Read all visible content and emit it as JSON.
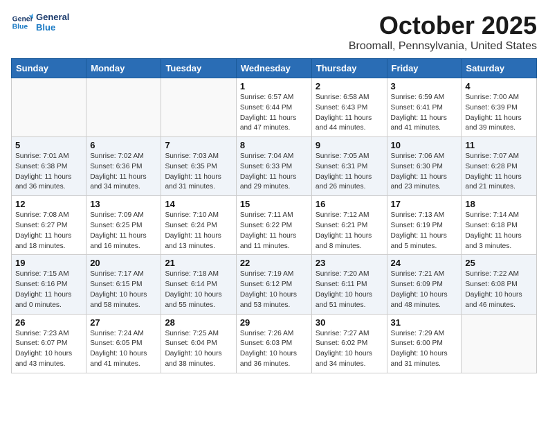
{
  "header": {
    "logo_line1": "General",
    "logo_line2": "Blue",
    "title": "October 2025",
    "subtitle": "Broomall, Pennsylvania, United States"
  },
  "weekdays": [
    "Sunday",
    "Monday",
    "Tuesday",
    "Wednesday",
    "Thursday",
    "Friday",
    "Saturday"
  ],
  "weeks": [
    [
      {
        "day": "",
        "info": ""
      },
      {
        "day": "",
        "info": ""
      },
      {
        "day": "",
        "info": ""
      },
      {
        "day": "1",
        "info": "Sunrise: 6:57 AM\nSunset: 6:44 PM\nDaylight: 11 hours\nand 47 minutes."
      },
      {
        "day": "2",
        "info": "Sunrise: 6:58 AM\nSunset: 6:43 PM\nDaylight: 11 hours\nand 44 minutes."
      },
      {
        "day": "3",
        "info": "Sunrise: 6:59 AM\nSunset: 6:41 PM\nDaylight: 11 hours\nand 41 minutes."
      },
      {
        "day": "4",
        "info": "Sunrise: 7:00 AM\nSunset: 6:39 PM\nDaylight: 11 hours\nand 39 minutes."
      }
    ],
    [
      {
        "day": "5",
        "info": "Sunrise: 7:01 AM\nSunset: 6:38 PM\nDaylight: 11 hours\nand 36 minutes."
      },
      {
        "day": "6",
        "info": "Sunrise: 7:02 AM\nSunset: 6:36 PM\nDaylight: 11 hours\nand 34 minutes."
      },
      {
        "day": "7",
        "info": "Sunrise: 7:03 AM\nSunset: 6:35 PM\nDaylight: 11 hours\nand 31 minutes."
      },
      {
        "day": "8",
        "info": "Sunrise: 7:04 AM\nSunset: 6:33 PM\nDaylight: 11 hours\nand 29 minutes."
      },
      {
        "day": "9",
        "info": "Sunrise: 7:05 AM\nSunset: 6:31 PM\nDaylight: 11 hours\nand 26 minutes."
      },
      {
        "day": "10",
        "info": "Sunrise: 7:06 AM\nSunset: 6:30 PM\nDaylight: 11 hours\nand 23 minutes."
      },
      {
        "day": "11",
        "info": "Sunrise: 7:07 AM\nSunset: 6:28 PM\nDaylight: 11 hours\nand 21 minutes."
      }
    ],
    [
      {
        "day": "12",
        "info": "Sunrise: 7:08 AM\nSunset: 6:27 PM\nDaylight: 11 hours\nand 18 minutes."
      },
      {
        "day": "13",
        "info": "Sunrise: 7:09 AM\nSunset: 6:25 PM\nDaylight: 11 hours\nand 16 minutes."
      },
      {
        "day": "14",
        "info": "Sunrise: 7:10 AM\nSunset: 6:24 PM\nDaylight: 11 hours\nand 13 minutes."
      },
      {
        "day": "15",
        "info": "Sunrise: 7:11 AM\nSunset: 6:22 PM\nDaylight: 11 hours\nand 11 minutes."
      },
      {
        "day": "16",
        "info": "Sunrise: 7:12 AM\nSunset: 6:21 PM\nDaylight: 11 hours\nand 8 minutes."
      },
      {
        "day": "17",
        "info": "Sunrise: 7:13 AM\nSunset: 6:19 PM\nDaylight: 11 hours\nand 5 minutes."
      },
      {
        "day": "18",
        "info": "Sunrise: 7:14 AM\nSunset: 6:18 PM\nDaylight: 11 hours\nand 3 minutes."
      }
    ],
    [
      {
        "day": "19",
        "info": "Sunrise: 7:15 AM\nSunset: 6:16 PM\nDaylight: 11 hours\nand 0 minutes."
      },
      {
        "day": "20",
        "info": "Sunrise: 7:17 AM\nSunset: 6:15 PM\nDaylight: 10 hours\nand 58 minutes."
      },
      {
        "day": "21",
        "info": "Sunrise: 7:18 AM\nSunset: 6:14 PM\nDaylight: 10 hours\nand 55 minutes."
      },
      {
        "day": "22",
        "info": "Sunrise: 7:19 AM\nSunset: 6:12 PM\nDaylight: 10 hours\nand 53 minutes."
      },
      {
        "day": "23",
        "info": "Sunrise: 7:20 AM\nSunset: 6:11 PM\nDaylight: 10 hours\nand 51 minutes."
      },
      {
        "day": "24",
        "info": "Sunrise: 7:21 AM\nSunset: 6:09 PM\nDaylight: 10 hours\nand 48 minutes."
      },
      {
        "day": "25",
        "info": "Sunrise: 7:22 AM\nSunset: 6:08 PM\nDaylight: 10 hours\nand 46 minutes."
      }
    ],
    [
      {
        "day": "26",
        "info": "Sunrise: 7:23 AM\nSunset: 6:07 PM\nDaylight: 10 hours\nand 43 minutes."
      },
      {
        "day": "27",
        "info": "Sunrise: 7:24 AM\nSunset: 6:05 PM\nDaylight: 10 hours\nand 41 minutes."
      },
      {
        "day": "28",
        "info": "Sunrise: 7:25 AM\nSunset: 6:04 PM\nDaylight: 10 hours\nand 38 minutes."
      },
      {
        "day": "29",
        "info": "Sunrise: 7:26 AM\nSunset: 6:03 PM\nDaylight: 10 hours\nand 36 minutes."
      },
      {
        "day": "30",
        "info": "Sunrise: 7:27 AM\nSunset: 6:02 PM\nDaylight: 10 hours\nand 34 minutes."
      },
      {
        "day": "31",
        "info": "Sunrise: 7:29 AM\nSunset: 6:00 PM\nDaylight: 10 hours\nand 31 minutes."
      },
      {
        "day": "",
        "info": ""
      }
    ]
  ]
}
